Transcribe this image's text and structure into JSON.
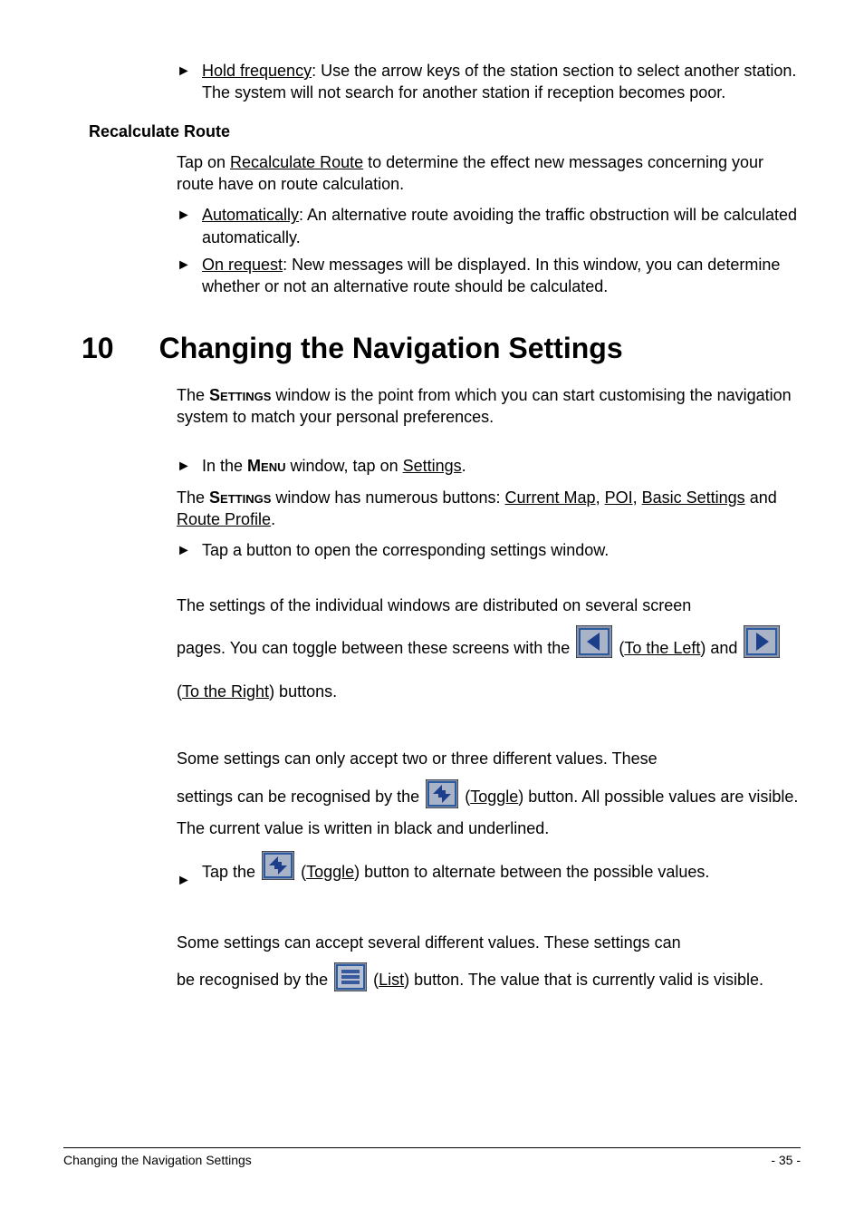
{
  "top": {
    "hold_freq": "Hold frequency",
    "hold_freq_rest": ": Use the arrow keys of the station section to select another station. The system will not search for another station if reception becomes poor."
  },
  "recalc": {
    "heading": "Recalculate Route",
    "intro_pre": "Tap on ",
    "intro_link": "Recalculate Route",
    "intro_post": " to determine the effect new messages concerning your route have on route calculation.",
    "auto_label": "Automatically",
    "auto_rest": ": An alternative route avoiding the traffic obstruction will be calculated automatically.",
    "onreq_label": "On request",
    "onreq_rest": ": New messages will be displayed. In this window, you can determine whether or not an alternative route should be calculated."
  },
  "h1": {
    "num": "10",
    "title": "Changing the Navigation Settings"
  },
  "body": {
    "p1_a": "The ",
    "p1_settings": "Settings",
    "p1_b": " window is the point from which you can start customising the navigation system to match your personal preferences.",
    "b1_a": "In the ",
    "b1_menu": "Menu",
    "b1_b": " window, tap on ",
    "b1_settings": "Settings",
    "b1_c": ".",
    "p2_a": "The ",
    "p2_settings": "Settings",
    "p2_b": " window has numerous buttons: ",
    "p2_curmap": "Current Map",
    "p2_comma1": ", ",
    "p2_poi": "POI",
    "p2_comma2": ", ",
    "p2_basic": "Basic Settings",
    "p2_and": " and ",
    "p2_route": "Route Profile",
    "p2_dot": ".",
    "b2": "Tap a button to open the corresponding settings window.",
    "p3a": "The settings of the individual windows are distributed on several screen",
    "p3b_a": "pages. You can toggle between these screens with the ",
    "p3b_b": " (",
    "p3b_link": "To the Left",
    "p3b_c": ") and ",
    "p3b_d": " (",
    "p3b_link2": "To the Right",
    "p3b_e": ") buttons.",
    "p4a": "Some settings can only accept two or three different values. These",
    "p4b_a": "settings can be recognised by the ",
    "p4b_b": " (",
    "p4b_link": "Toggle",
    "p4b_c": ") button. All possible values are visible. The current value is written in black and underlined.",
    "b3_a": "Tap the ",
    "b3_b": " (",
    "b3_link": "Toggle",
    "b3_c": ") button to alternate between the possible values.",
    "p5a": "Some settings can accept several different values. These settings can",
    "p5b_a": "be recognised by the ",
    "p5b_b": " (",
    "p5b_link": "List",
    "p5b_c": ") button. The value that is currently valid is visible."
  },
  "footer": {
    "left": "Changing the Navigation Settings",
    "right": "- 35 -"
  }
}
